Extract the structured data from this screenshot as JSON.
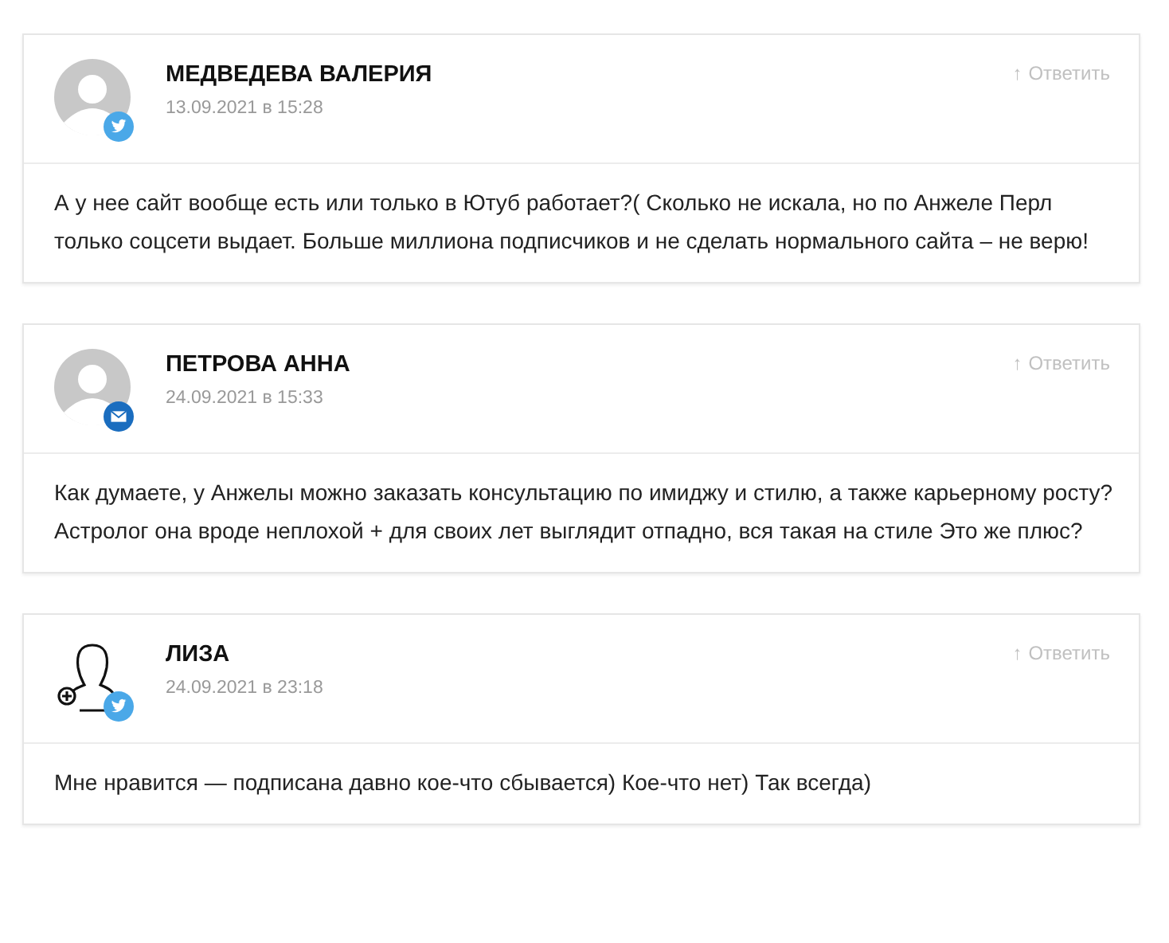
{
  "comments": [
    {
      "author": "МЕДВЕДЕВА ВАЛЕРИЯ",
      "date": "13.09.2021 в 15:28",
      "avatar": {
        "kind": "default"
      },
      "badge": {
        "kind": "twitter"
      },
      "reply": "Ответить",
      "reply_arrow": "↑",
      "text": "А у нее сайт вообще есть или только в Ютуб работает?( Сколько не искала, но по Анжеле Перл только соцсети выдает. Больше миллиона подписчиков и не сделать нормального сайта – не верю!"
    },
    {
      "author": "ПЕТРОВА АННА",
      "date": "24.09.2021 в 15:33",
      "avatar": {
        "kind": "default"
      },
      "badge": {
        "kind": "mail"
      },
      "reply": "Ответить",
      "reply_arrow": "↑",
      "text": "Как думаете, у Анжелы можно заказать консультацию по имиджу и стилю, а также карьерному росту? Астролог она вроде неплохой + для своих лет выглядит отпадно, вся такая на стиле Это же плюс?"
    },
    {
      "author": "ЛИЗА",
      "date": "24.09.2021 в 23:18",
      "avatar": {
        "kind": "outline"
      },
      "badge": {
        "kind": "twitter"
      },
      "reply": "Ответить",
      "reply_arrow": "↑",
      "text": "Мне нравится — подписана давно кое-что сбывается) Кое-что нет) Так всегда)"
    }
  ]
}
